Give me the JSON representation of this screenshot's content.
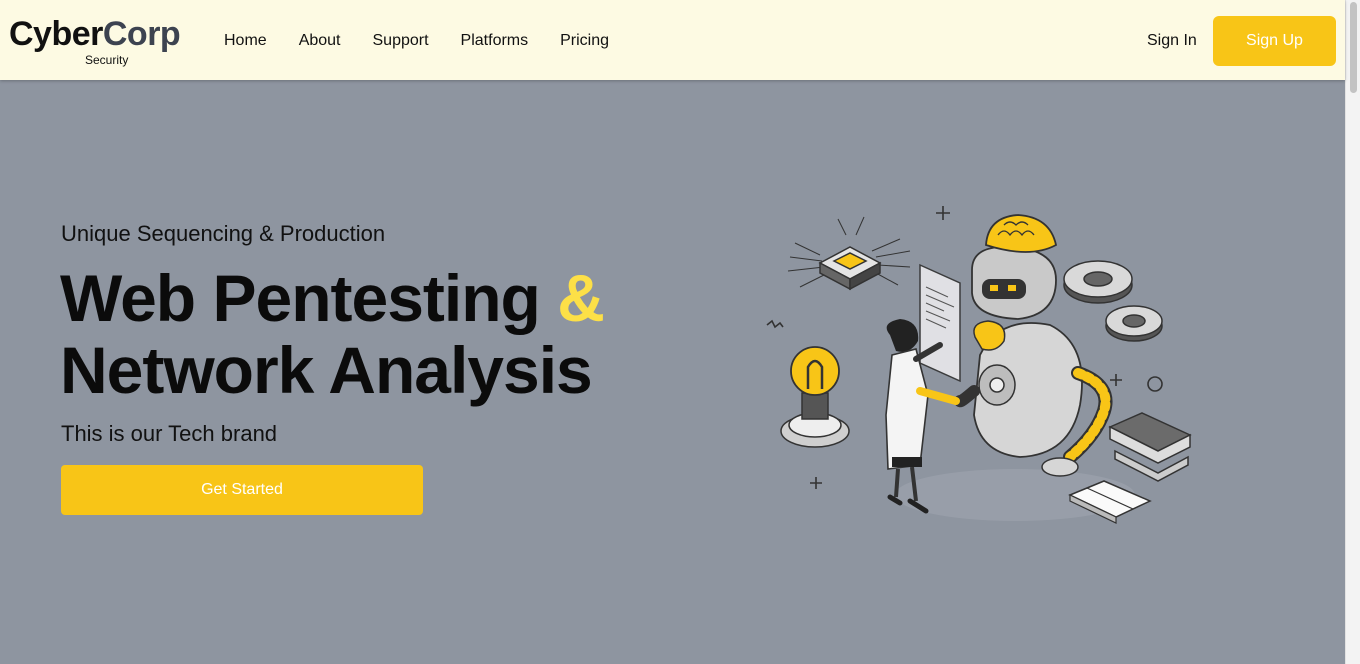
{
  "brand": {
    "name_part1": "Cyber",
    "name_part2": "Corp",
    "tagline": "Security"
  },
  "nav": {
    "links": [
      "Home",
      "About",
      "Support",
      "Platforms",
      "Pricing"
    ],
    "sign_in": "Sign In",
    "sign_up": "Sign Up"
  },
  "hero": {
    "eyebrow": "Unique Sequencing & Production",
    "title_line1": "Web Pentesting",
    "title_amp": "&",
    "title_line2": "Network Analysis",
    "subtitle": "This is our Tech brand",
    "cta": "Get Started"
  },
  "colors": {
    "accent": "#f8c517",
    "navbar_bg": "#fdfae3",
    "hero_bg": "#8e95a0",
    "ampersand": "#fde047"
  },
  "illustration": {
    "icon": "ai-robot-scientist-illustration"
  }
}
